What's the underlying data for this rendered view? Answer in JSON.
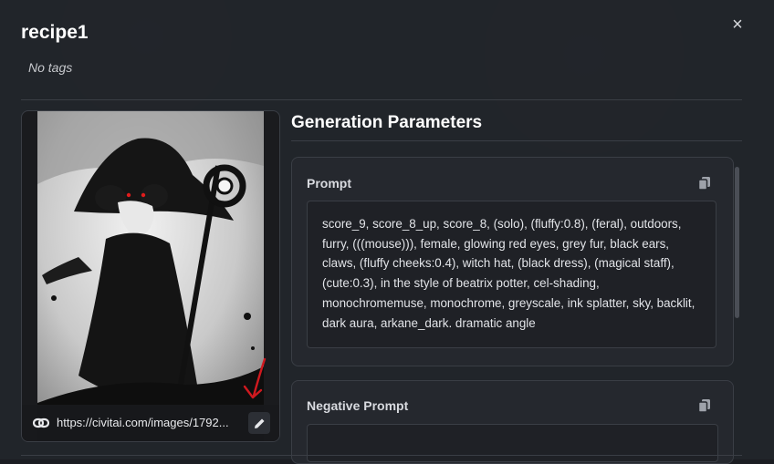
{
  "modal": {
    "title": "recipe1",
    "tags": "No tags",
    "close_symbol": "×"
  },
  "image": {
    "url": "https://civitai.com/images/1792...",
    "description_icons": [
      "link-icon",
      "pencil-icon"
    ]
  },
  "generation": {
    "title": "Generation Parameters",
    "prompt_label": "Prompt",
    "prompt_text": "score_9, score_8_up, score_8, (solo), (fluffy:0.8), (feral), outdoors, furry, (((mouse))), female, glowing red eyes, grey fur, black ears, claws, (fluffy cheeks:0.4), witch hat, (black dress), (magical staff), (cute:0.3), in the style of beatrix potter, cel-shading, monochromemuse, monochrome, greyscale, ink splatter, sky, backlit, dark aura, arkane_dark. dramatic angle",
    "negative_label": "Negative Prompt"
  },
  "colors": {
    "background": "#22252a",
    "panel": "#25282e",
    "border": "#3a3e45",
    "annotation": "#d0191f"
  }
}
